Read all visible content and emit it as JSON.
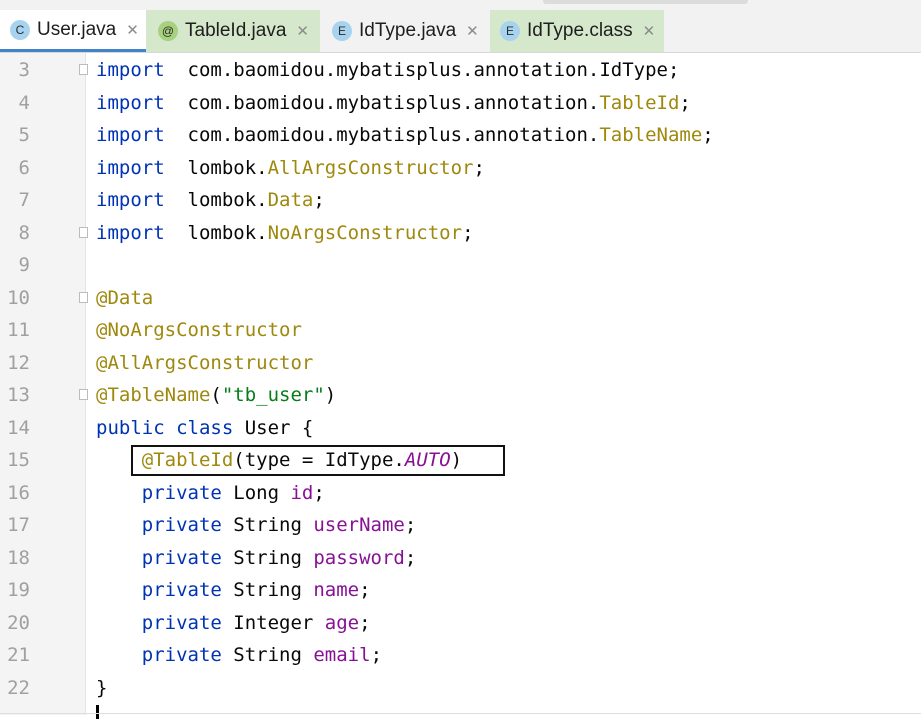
{
  "tabs": [
    {
      "label": "User.java",
      "icon": "class-c-icon",
      "glyph": "C",
      "active": true
    },
    {
      "label": "TableId.java",
      "icon": "annotation-at-icon",
      "glyph": "@",
      "active": false
    },
    {
      "label": "IdType.java",
      "icon": "enum-e-icon",
      "glyph": "E",
      "active": false
    },
    {
      "label": "IdType.class",
      "icon": "enum-e-icon",
      "glyph": "E",
      "active": false
    }
  ],
  "close_glyph": "✕",
  "lines": [
    {
      "n": "3",
      "t": [
        [
          "kw",
          "import"
        ],
        [
          "",
          "  com.baomidou.mybatisplus.annotation.IdType;"
        ]
      ]
    },
    {
      "n": "4",
      "t": [
        [
          "kw",
          "import"
        ],
        [
          "",
          "  com.baomidou.mybatisplus.annotation."
        ],
        [
          "an",
          "TableId"
        ],
        [
          "",
          ";"
        ]
      ]
    },
    {
      "n": "5",
      "t": [
        [
          "kw",
          "import"
        ],
        [
          "",
          "  com.baomidou.mybatisplus.annotation."
        ],
        [
          "an",
          "TableName"
        ],
        [
          "",
          ";"
        ]
      ]
    },
    {
      "n": "6",
      "t": [
        [
          "kw",
          "import"
        ],
        [
          "",
          "  lombok."
        ],
        [
          "an",
          "AllArgsConstructor"
        ],
        [
          "",
          ";"
        ]
      ]
    },
    {
      "n": "7",
      "t": [
        [
          "kw",
          "import"
        ],
        [
          "",
          "  lombok."
        ],
        [
          "an",
          "Data"
        ],
        [
          "",
          ";"
        ]
      ]
    },
    {
      "n": "8",
      "t": [
        [
          "kw",
          "import"
        ],
        [
          "",
          "  lombok."
        ],
        [
          "an",
          "NoArgsConstructor"
        ],
        [
          "",
          ";"
        ]
      ]
    },
    {
      "n": "9",
      "t": []
    },
    {
      "n": "10",
      "t": [
        [
          "an",
          "@Data"
        ]
      ]
    },
    {
      "n": "11",
      "t": [
        [
          "an",
          "@NoArgsConstructor"
        ]
      ]
    },
    {
      "n": "12",
      "t": [
        [
          "an",
          "@AllArgsConstructor"
        ]
      ]
    },
    {
      "n": "13",
      "t": [
        [
          "an",
          "@TableName"
        ],
        [
          "",
          "("
        ],
        [
          "st",
          "\"tb_user\""
        ],
        [
          "",
          ")"
        ]
      ]
    },
    {
      "n": "14",
      "t": [
        [
          "kw",
          "public class"
        ],
        [
          "",
          " User {"
        ]
      ]
    },
    {
      "n": "15",
      "t": [
        [
          "",
          "    "
        ],
        [
          "an",
          "@TableId"
        ],
        [
          "",
          "(type = IdType."
        ],
        [
          "it",
          "AUTO"
        ],
        [
          "",
          ")"
        ]
      ]
    },
    {
      "n": "16",
      "t": [
        [
          "",
          "    "
        ],
        [
          "kw",
          "private"
        ],
        [
          "",
          " Long "
        ],
        [
          "fd",
          "id"
        ],
        [
          "",
          ";"
        ]
      ]
    },
    {
      "n": "17",
      "t": [
        [
          "",
          "    "
        ],
        [
          "kw",
          "private"
        ],
        [
          "",
          " String "
        ],
        [
          "fd",
          "userName"
        ],
        [
          "",
          ";"
        ]
      ]
    },
    {
      "n": "18",
      "t": [
        [
          "",
          "    "
        ],
        [
          "kw",
          "private"
        ],
        [
          "",
          " String "
        ],
        [
          "fd",
          "password"
        ],
        [
          "",
          ";"
        ]
      ]
    },
    {
      "n": "19",
      "t": [
        [
          "",
          "    "
        ],
        [
          "kw",
          "private"
        ],
        [
          "",
          " String "
        ],
        [
          "fd",
          "name"
        ],
        [
          "",
          ";"
        ]
      ]
    },
    {
      "n": "20",
      "t": [
        [
          "",
          "    "
        ],
        [
          "kw",
          "private"
        ],
        [
          "",
          " Integer "
        ],
        [
          "fd",
          "age"
        ],
        [
          "",
          ";"
        ]
      ]
    },
    {
      "n": "21",
      "t": [
        [
          "",
          "    "
        ],
        [
          "kw",
          "private"
        ],
        [
          "",
          " String "
        ],
        [
          "fd",
          "email"
        ],
        [
          "",
          ";"
        ]
      ]
    },
    {
      "n": "22",
      "t": [
        [
          "",
          "}"
        ]
      ]
    }
  ]
}
